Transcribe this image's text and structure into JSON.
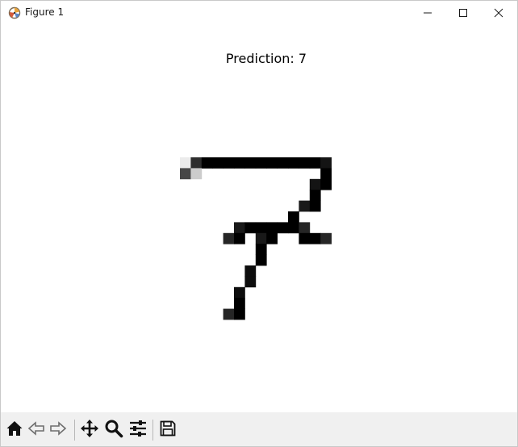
{
  "window": {
    "title": "Figure 1",
    "icon": "matplotlib-icon",
    "controls": [
      "minimize-icon",
      "maximize-icon",
      "close-icon"
    ]
  },
  "figure": {
    "title": "Prediction: 7",
    "colormap": "gray_r",
    "image_size": [
      28,
      28
    ],
    "image_rows": [
      {
        "row": 7,
        "pixels": [
          [
            8,
            0.08
          ],
          [
            9,
            0.82
          ],
          [
            10,
            1
          ],
          [
            11,
            1
          ],
          [
            12,
            1
          ],
          [
            13,
            1
          ],
          [
            14,
            1
          ],
          [
            15,
            1
          ],
          [
            16,
            1
          ],
          [
            17,
            1
          ],
          [
            18,
            1
          ],
          [
            19,
            1
          ],
          [
            20,
            1
          ],
          [
            21,
            0.92
          ]
        ]
      },
      {
        "row": 8,
        "pixels": [
          [
            8,
            0.72
          ],
          [
            9,
            0.2
          ],
          [
            21,
            1
          ]
        ]
      },
      {
        "row": 9,
        "pixels": [
          [
            20,
            0.92
          ],
          [
            21,
            1
          ]
        ]
      },
      {
        "row": 10,
        "pixels": [
          [
            20,
            1
          ]
        ]
      },
      {
        "row": 11,
        "pixels": [
          [
            19,
            0.9
          ],
          [
            20,
            1
          ]
        ]
      },
      {
        "row": 12,
        "pixels": [
          [
            18,
            1
          ]
        ]
      },
      {
        "row": 13,
        "pixels": [
          [
            13,
            0.9
          ],
          [
            14,
            1
          ],
          [
            15,
            1
          ],
          [
            16,
            1
          ],
          [
            17,
            1
          ],
          [
            18,
            1
          ],
          [
            19,
            0.85
          ]
        ]
      },
      {
        "row": 14,
        "pixels": [
          [
            12,
            0.85
          ],
          [
            13,
            1
          ],
          [
            15,
            0.9
          ],
          [
            16,
            1
          ],
          [
            19,
            1
          ],
          [
            20,
            1
          ],
          [
            21,
            0.85
          ]
        ]
      },
      {
        "row": 15,
        "pixels": [
          [
            15,
            1
          ]
        ]
      },
      {
        "row": 16,
        "pixels": [
          [
            15,
            1
          ]
        ]
      },
      {
        "row": 17,
        "pixels": [
          [
            14,
            0.95
          ]
        ]
      },
      {
        "row": 18,
        "pixels": [
          [
            14,
            0.95
          ]
        ]
      },
      {
        "row": 19,
        "pixels": [
          [
            13,
            0.95
          ]
        ]
      },
      {
        "row": 20,
        "pixels": [
          [
            13,
            1
          ]
        ]
      },
      {
        "row": 21,
        "pixels": [
          [
            12,
            0.85
          ],
          [
            13,
            1
          ]
        ]
      }
    ]
  },
  "toolbar": {
    "tools": [
      {
        "name": "home-icon",
        "label": "Home"
      },
      {
        "name": "back-icon",
        "label": "Back"
      },
      {
        "name": "forward-icon",
        "label": "Forward"
      },
      {
        "name": "pan-icon",
        "label": "Pan"
      },
      {
        "name": "zoom-icon",
        "label": "Zoom"
      },
      {
        "name": "configure-subplots-icon",
        "label": "Subplots"
      },
      {
        "name": "save-icon",
        "label": "Save"
      }
    ]
  }
}
